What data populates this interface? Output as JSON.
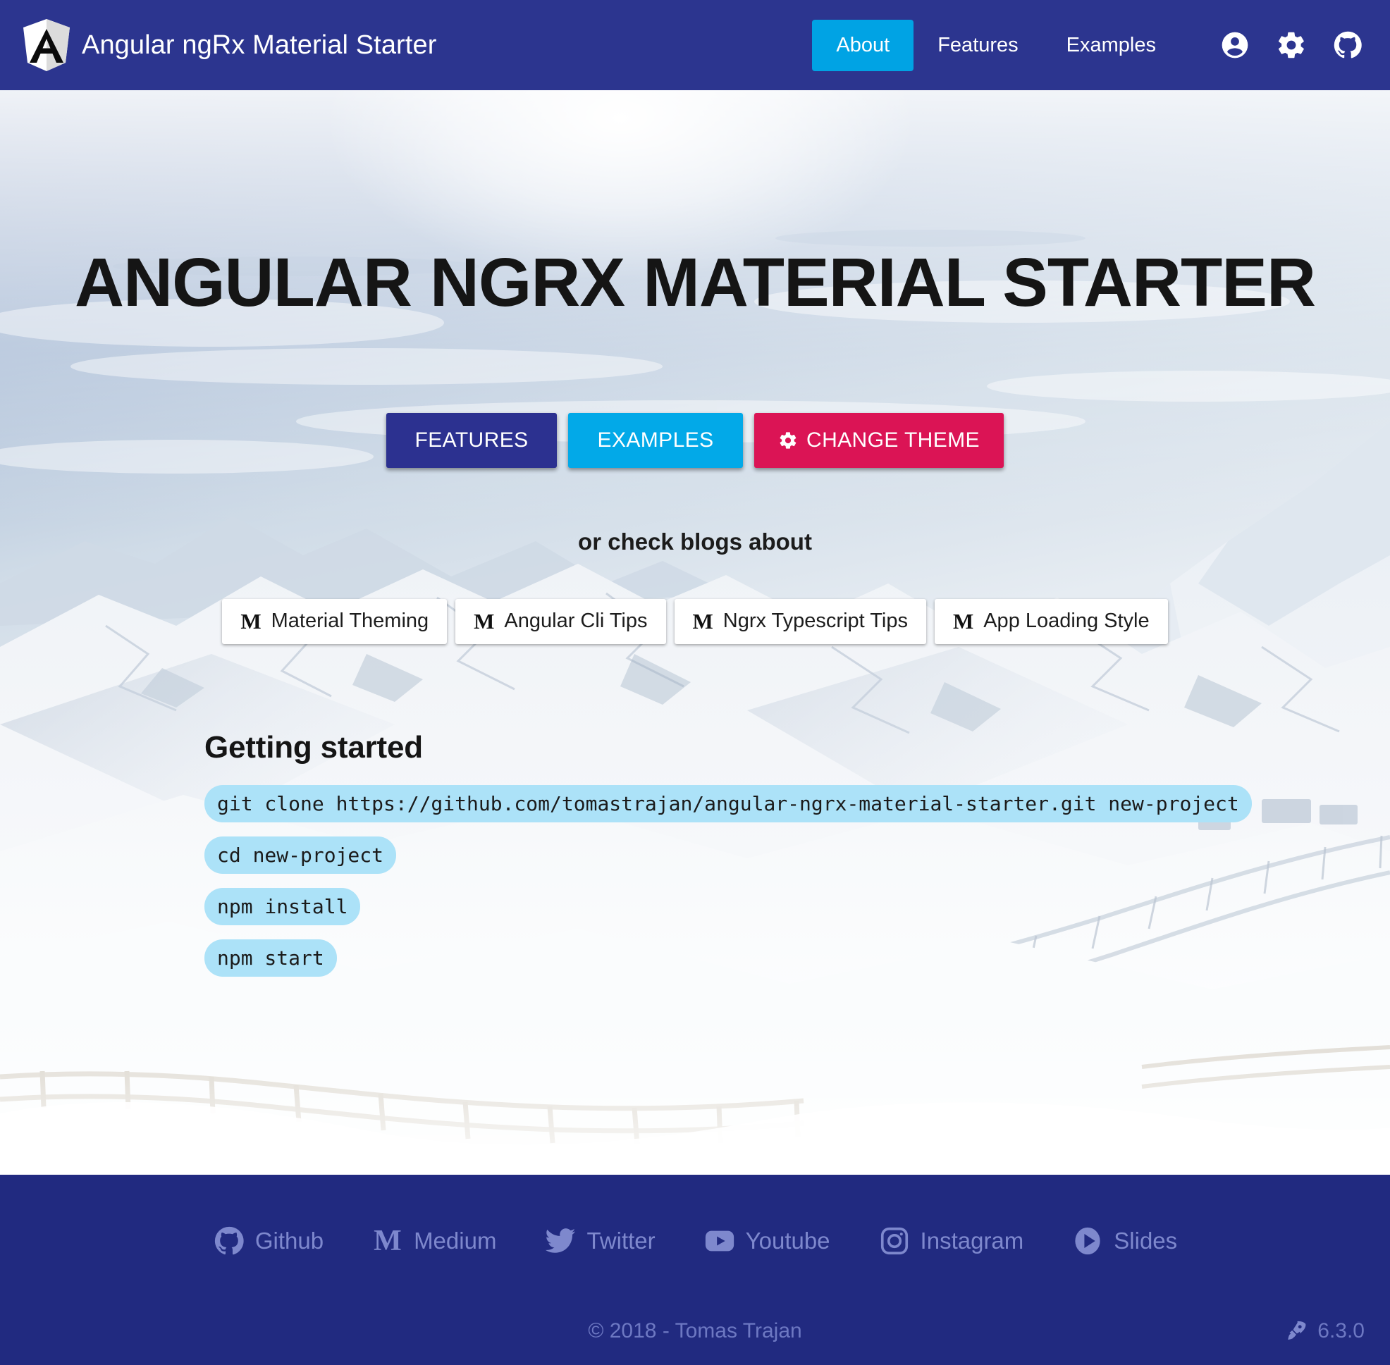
{
  "header": {
    "logo_icon": "angular-shield-icon",
    "brand_title": "Angular ngRx Material Starter",
    "nav": [
      {
        "label": "About",
        "active": true
      },
      {
        "label": "Features",
        "active": false
      },
      {
        "label": "Examples",
        "active": false
      }
    ],
    "icons": [
      {
        "name": "account-circle-icon"
      },
      {
        "name": "settings-gear-icon"
      },
      {
        "name": "github-icon"
      }
    ],
    "background_color": "#2c358f",
    "active_nav_color": "#00a3e4"
  },
  "hero": {
    "title": "ANGULAR NGRX MATERIAL STARTER",
    "buttons": [
      {
        "label": "FEATURES",
        "color": "#2c3190",
        "icon": null
      },
      {
        "label": "EXAMPLES",
        "color": "#02a9e8",
        "icon": null
      },
      {
        "label": "CHANGE THEME",
        "color": "#db1455",
        "icon": "gear-icon"
      }
    ],
    "blogs_label": "or check blogs about",
    "blog_chips": [
      {
        "icon": "medium-m-icon",
        "label": "Material Theming"
      },
      {
        "icon": "medium-m-icon",
        "label": "Angular Cli Tips"
      },
      {
        "icon": "medium-m-icon",
        "label": "Ngrx Typescript Tips"
      },
      {
        "icon": "medium-m-icon",
        "label": "App Loading Style"
      }
    ],
    "getting_started": {
      "title": "Getting started",
      "commands": [
        "git clone https://github.com/tomastrajan/angular-ngrx-material-starter.git new-project",
        "cd new-project",
        "npm install",
        "npm start"
      ],
      "code_highlight_color": "#ace2f8"
    }
  },
  "footer": {
    "background_color": "#212a80",
    "link_color": "#7e88cd",
    "social_links": [
      {
        "icon": "github-icon",
        "label": "Github"
      },
      {
        "icon": "medium-m-icon",
        "label": "Medium"
      },
      {
        "icon": "twitter-bird-icon",
        "label": "Twitter"
      },
      {
        "icon": "youtube-icon",
        "label": "Youtube"
      },
      {
        "icon": "instagram-icon",
        "label": "Instagram"
      },
      {
        "icon": "slides-play-icon",
        "label": "Slides"
      }
    ],
    "copyright": "© 2018 - Tomas Trajan",
    "version": "6.3.0",
    "version_icon": "rocket-icon"
  }
}
